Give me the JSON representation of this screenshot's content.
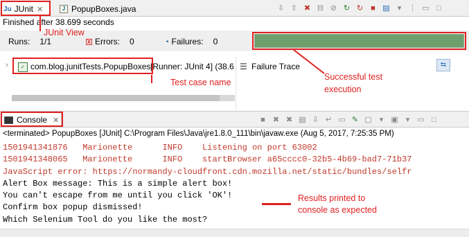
{
  "tabs": [
    {
      "label": "JUnit",
      "icon": "junit-icon",
      "close": "✕"
    },
    {
      "label": "PopupBoxes.java",
      "icon": "java-file-icon"
    }
  ],
  "status": "Finished after 38.699 seconds",
  "counters": {
    "runs_label": "Runs:",
    "runs_value": "1/1",
    "errors_label": "Errors:",
    "errors_value": "0",
    "failures_label": "Failures:",
    "failures_value": "0"
  },
  "progress": {
    "fraction": 1.0,
    "color": "#6ea06e"
  },
  "tree": {
    "label": "com.blog.junitTests.PopupBoxes",
    "runner": "[Runner: JUnit 4] (38.6"
  },
  "failure_trace_label": "Failure Trace",
  "console": {
    "tab_label": "Console",
    "terminated": "<terminated> PopupBoxes [JUnit] C:\\Program Files\\Java\\jre1.8.0_111\\bin\\javaw.exe (Aug 5, 2017, 7:25:35 PM)",
    "lines": [
      {
        "text": "1501941341876   Marionette      INFO    Listening on port 63002",
        "color": "red"
      },
      {
        "text": "1501941348065   Marionette      INFO    startBrowser a65cccc0-32b5-4b69-bad7-71b37",
        "color": "red"
      },
      {
        "text": "JavaScript error: https://normandy-cloudfront.cdn.mozilla.net/static/bundles/selfr",
        "color": "red"
      },
      {
        "text": "Alert Box message: This is a simple alert box!",
        "color": "black"
      },
      {
        "text": "You can't escape from me until you click 'OK'!",
        "color": "black"
      },
      {
        "text": "Confirm box popup dismissed!",
        "color": "black"
      },
      {
        "text": "Which Selenium Tool do you like the most?",
        "color": "black"
      }
    ]
  },
  "annotations": {
    "junit_view": "JUnit View",
    "test_case_name": "Test case name",
    "successful_line1": "Successful test",
    "successful_line2": "execution",
    "results_line1": "Results printed to",
    "results_line2": "console as expected"
  },
  "colors": {
    "annotation": "#e02020",
    "accent": "#2a6bb3"
  }
}
